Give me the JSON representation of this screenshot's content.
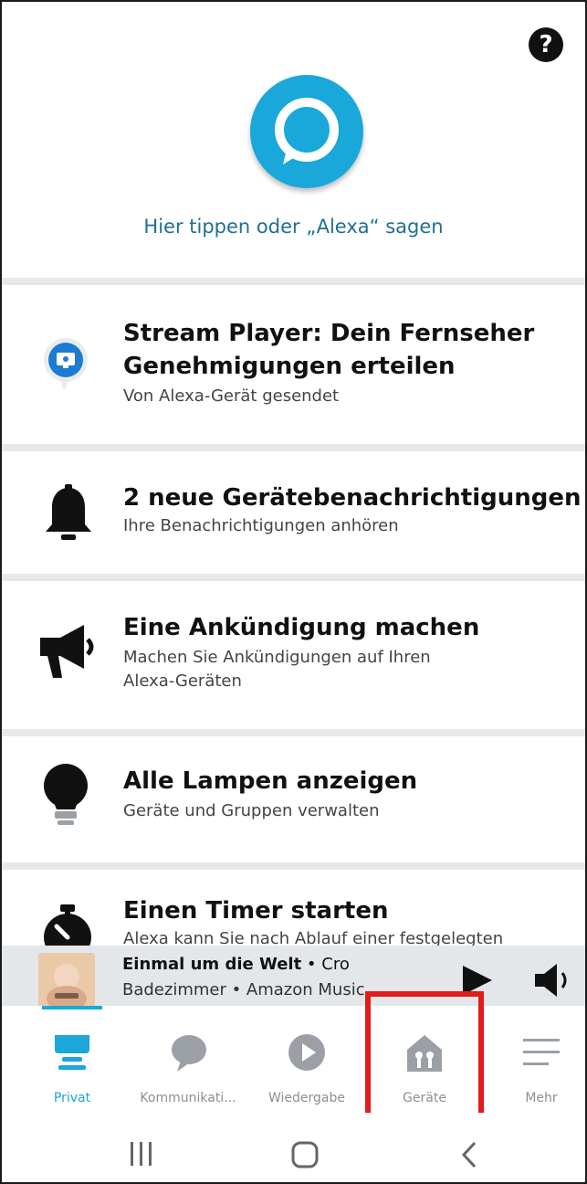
{
  "header": {
    "help_icon": "question-mark-icon",
    "alexa_prompt": "Hier tippen oder „Alexa“ sagen"
  },
  "cards": [
    {
      "icon": "stream-player-icon",
      "title_line1": "Stream Player: Dein Fernseher",
      "title_line2": "Genehmigungen erteilen",
      "subtitle": "Von Alexa-Gerät gesendet"
    },
    {
      "icon": "bell-icon",
      "title": "2 neue Gerätebenachrichtigungen",
      "subtitle": "Ihre Benachrichtigungen anhören"
    },
    {
      "icon": "megaphone-icon",
      "title": "Eine Ankündigung machen",
      "subtitle_line1": "Machen Sie Ankündigungen auf Ihren",
      "subtitle_line2": "Alexa-Geräten"
    },
    {
      "icon": "lightbulb-icon",
      "title": "Alle Lampen anzeigen",
      "subtitle": "Geräte und Gruppen verwalten"
    },
    {
      "icon": "timer-icon",
      "title": "Einen Timer starten",
      "subtitle": "Alexa kann Sie nach Ablauf einer festgelegten"
    }
  ],
  "now_playing": {
    "song": "Einmal um die Welt",
    "separator": " • ",
    "artist": "Cro",
    "device_line": "Badezimmer • Amazon Music"
  },
  "nav": {
    "items": [
      {
        "label": "Privat",
        "icon": "home-list-icon",
        "active": true
      },
      {
        "label": "Kommunikati...",
        "icon": "speech-bubble-icon",
        "active": false
      },
      {
        "label": "Wiedergabe",
        "icon": "play-circle-icon",
        "active": false
      },
      {
        "label": "Geräte",
        "icon": "smart-home-icon",
        "active": false
      },
      {
        "label": "Mehr",
        "icon": "menu-icon",
        "active": false
      }
    ]
  },
  "colors": {
    "accent": "#1aa7d9",
    "highlight": "#e31b1b",
    "separator": "#e6e8e9"
  }
}
